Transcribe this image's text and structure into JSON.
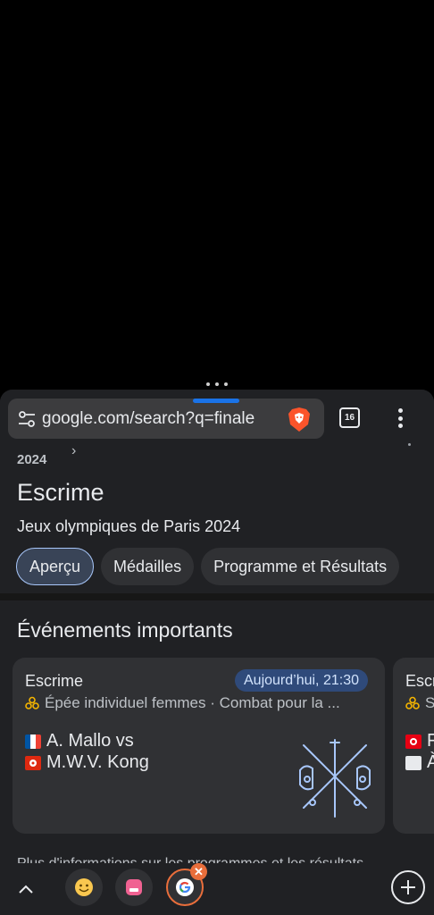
{
  "browser": {
    "url": "google.com/search?q=finale",
    "tab_count": "16"
  },
  "breadcrumb": {
    "year": "2024"
  },
  "header": {
    "title": "Escrime",
    "subtitle": "Jeux olympiques de Paris 2024"
  },
  "tabs": [
    {
      "label": "Aperçu",
      "active": true
    },
    {
      "label": "Médailles",
      "active": false
    },
    {
      "label": "Programme et Résultats",
      "active": false
    }
  ],
  "events_section": {
    "title": "Événements importants",
    "cards": [
      {
        "sport": "Escrime",
        "time": "Aujourd’hui, 21:30",
        "event": "Épée individuel femmes",
        "round": "Combat pour la ...",
        "team1": "A. Mallo vs",
        "team2": "M.W.V. Kong"
      },
      {
        "sport": "Escr",
        "event": "S",
        "team1": "F",
        "team2": "À"
      }
    ]
  },
  "footer_text": "Plus d'informations sur les programmes et les résultats",
  "bottom_bar": {
    "icons": [
      "expand-up-icon",
      "smile-tab-icon",
      "pink-tab-icon",
      "google-tab-icon",
      "close-icon",
      "new-tab-icon"
    ]
  },
  "colors": {
    "accent": "#1a73e8",
    "active_chip_border": "#a8c7fa",
    "badge_bg": "#2f4a7a",
    "brave": "#fb542b",
    "active_bubble": "#e96e3b"
  }
}
